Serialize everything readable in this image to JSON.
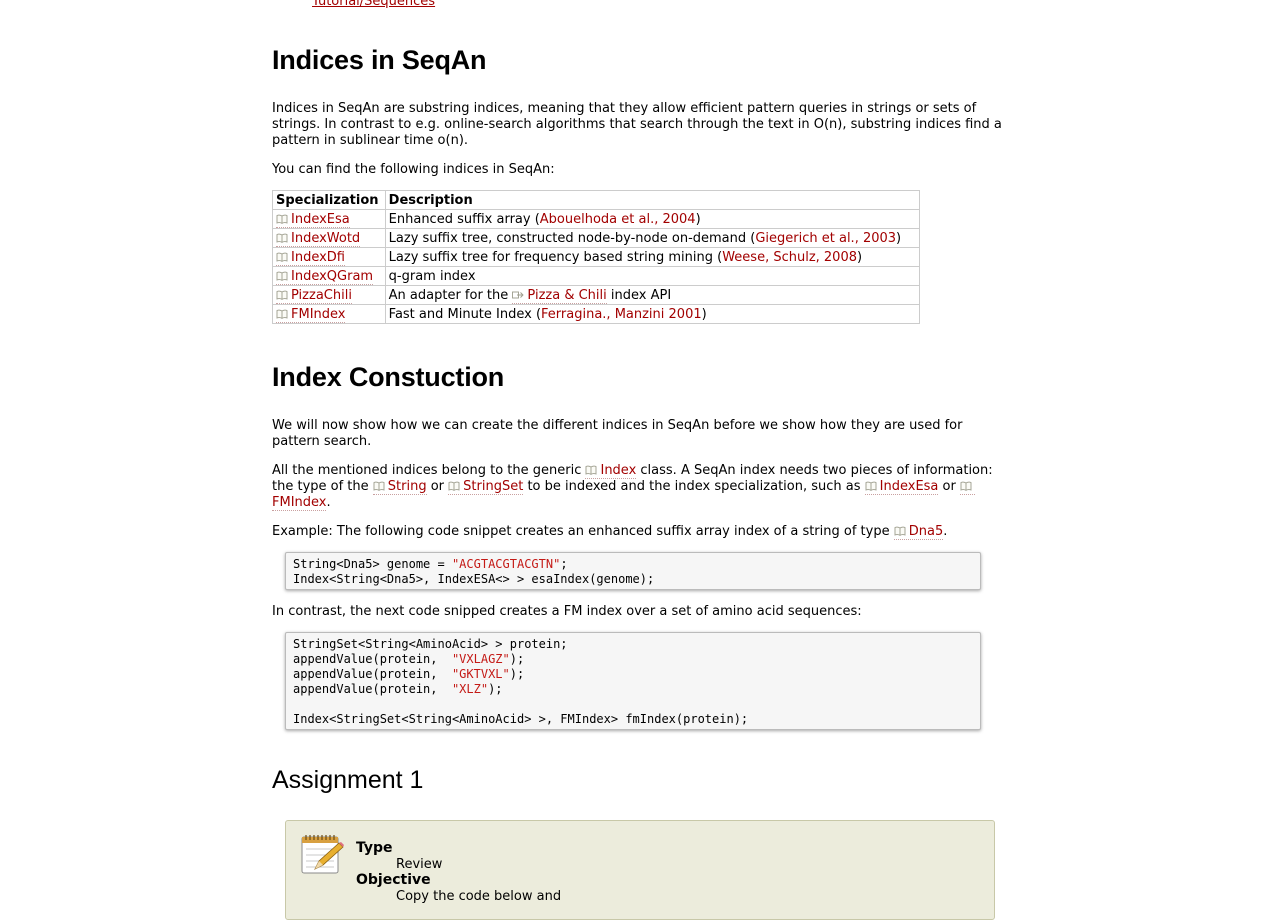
{
  "breadcrumb": "Tutorial/Sequences",
  "section1": {
    "title": "Indices in SeqAn",
    "para1": "Indices in SeqAn are substring indices, meaning that they allow efficient pattern queries in strings or sets of strings. In contrast to e.g. online-search algorithms that search through the text in O(n), substring indices find a pattern in sublinear time o(n).",
    "para2": "You can find the following indices in SeqAn:",
    "table": {
      "headers": [
        "Specialization",
        "Description"
      ],
      "rows": [
        {
          "spec": "IndexEsa",
          "pre": "Enhanced suffix array (",
          "ref": "Abouelhoda et al., 2004",
          "post": ")"
        },
        {
          "spec": "IndexWotd",
          "pre": "Lazy suffix tree, constructed node-by-node on-demand (",
          "ref": "Giegerich et al., 2003",
          "post": ")"
        },
        {
          "spec": "IndexDfi",
          "pre": "Lazy suffix tree for frequency based string mining (",
          "ref": "Weese, Schulz, 2008",
          "post": ")"
        },
        {
          "spec": "IndexQGram",
          "pre": "q-gram index",
          "ref": "",
          "post": ""
        },
        {
          "spec": "PizzaChili",
          "pre": "An adapter for the ",
          "ref": "Pizza & Chili",
          "post": " index API"
        },
        {
          "spec": "FMIndex",
          "pre": "Fast and Minute Index (",
          "ref": "Ferragina., Manzini 2001",
          "post": ")"
        }
      ]
    }
  },
  "section2": {
    "title": "Index Constuction",
    "para1": "We will now show how we can create the different indices in SeqAn before we show how they are used for pattern search.",
    "para2": {
      "t1": "All the mentioned indices belong to the generic ",
      "l1": "Index",
      "t2": " class. A SeqAn index needs two pieces of information: the type of the ",
      "l2": "String",
      "t3": " or ",
      "l3": "StringSet",
      "t4": " to be indexed and the index specialization, such as ",
      "l4": "IndexEsa",
      "t5": " or ",
      "l5": "FMIndex",
      "t6": "."
    },
    "para3": {
      "t1": "Example: The following code snippet creates an enhanced suffix array index of a string of type ",
      "l1": "Dna5",
      "t2": "."
    },
    "code1": {
      "line1a": "String<Dna5> genome = ",
      "line1s": "\"ACGTACGTACGTN\"",
      "line1b": ";",
      "line2": "Index<String<Dna5>, IndexESA<> > esaIndex(genome);"
    },
    "para4": "In contrast, the next code snipped creates a FM index over a set of amino acid sequences:",
    "code2": {
      "line1": "StringSet<String<AminoAcid> > protein;",
      "line2a": "appendValue(protein,  ",
      "line2s": "\"VXLAGZ\"",
      "line2b": ");",
      "line3a": "appendValue(protein,  ",
      "line3s": "\"GKTVXL\"",
      "line3b": ");",
      "line4a": "appendValue(protein,  ",
      "line4s": "\"XLZ\"",
      "line4b": ");",
      "line6": "Index<StringSet<String<AminoAcid> >, FMIndex> fmIndex(protein);"
    }
  },
  "assignment": {
    "title": "Assignment 1",
    "type_label": "Type",
    "type_value": "Review",
    "objective_label": "Objective",
    "objective_value": "Copy the code below and"
  },
  "colors": {
    "link": "#a20000",
    "string_literal": "#c41a16",
    "assignment_bg": "#ececdc"
  },
  "icons": {
    "doc_link": "book-icon",
    "external_link": "external-link-icon",
    "assignment": "notepad-pencil-icon"
  }
}
